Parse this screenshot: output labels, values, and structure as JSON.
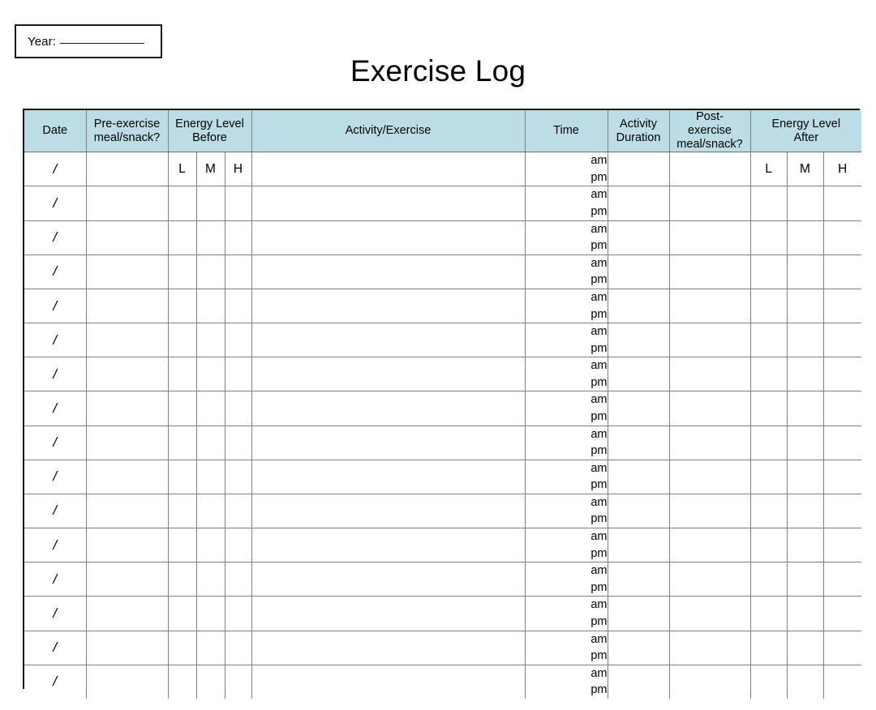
{
  "year_box": {
    "label": "Year:",
    "blank_rule": "____________"
  },
  "title": "Exercise Log",
  "colors": {
    "header_background": "#bcdde6",
    "outer_border": "#111111",
    "grid_line": "#808080",
    "text": "#000000",
    "page_background": "#ffffff"
  },
  "table": {
    "headers": [
      {
        "key": "date",
        "lines": [
          "Date"
        ],
        "colspan": 1
      },
      {
        "key": "pre_exercise_meal",
        "lines": [
          "Pre-exercise",
          "meal/snack?"
        ],
        "colspan": 1
      },
      {
        "key": "energy_level_before",
        "lines": [
          "Energy Level",
          "Before"
        ],
        "colspan": 3
      },
      {
        "key": "activity_exercise",
        "lines": [
          "Activity/Exercise"
        ],
        "colspan": 1
      },
      {
        "key": "time",
        "lines": [
          "Time"
        ],
        "colspan": 1
      },
      {
        "key": "activity_duration",
        "lines": [
          "Activity",
          "Duration"
        ],
        "colspan": 1
      },
      {
        "key": "post_exercise_meal",
        "lines": [
          "Post-",
          "exercise",
          "meal/snack?"
        ],
        "colspan": 1
      },
      {
        "key": "energy_level_after",
        "lines": [
          "Energy Level",
          "After"
        ],
        "colspan": 3
      }
    ],
    "energy_scale": [
      "L",
      "M",
      "H"
    ],
    "date_mark": "/",
    "time_options": [
      "am",
      "pm"
    ],
    "row_count": 16
  }
}
